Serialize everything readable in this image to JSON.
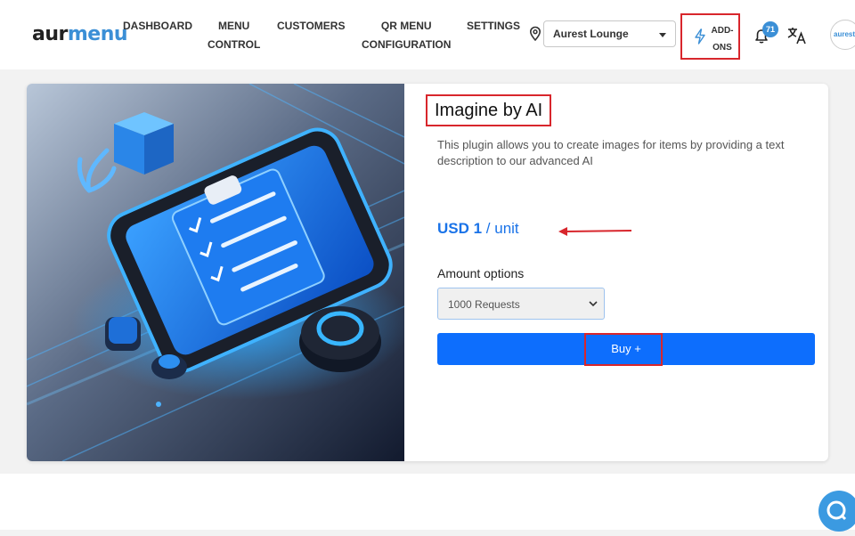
{
  "logo": {
    "part1": "aur",
    "part2": "menu"
  },
  "nav": [
    {
      "line1": "DASHBOARD",
      "line2": ""
    },
    {
      "line1": "MENU",
      "line2": "CONTROL"
    },
    {
      "line1": "CUSTOMERS",
      "line2": ""
    },
    {
      "line1": "QR MENU",
      "line2": "CONFIGURATION"
    },
    {
      "line1": "SETTINGS",
      "line2": ""
    }
  ],
  "location": {
    "selected": "Aurest Lounge"
  },
  "addons": {
    "line1": "ADD-",
    "line2": "ONS"
  },
  "notifications": {
    "count": "71"
  },
  "avatar": {
    "text": "aurest"
  },
  "product": {
    "title": "Imagine by AI",
    "description": "This plugin allows you to create images for items by providing a text description to our advanced AI",
    "price_currency": "USD 1",
    "price_unit": " / unit",
    "amount_label": "Amount options",
    "amount_selected": "1000 Requests",
    "buy_label": "Buy +"
  },
  "colors": {
    "accent": "#0d6efd",
    "highlight": "#d8262c",
    "brand": "#3b8fd6"
  },
  "icons": [
    "location-pin-icon",
    "lightning-icon",
    "bell-icon",
    "translate-icon",
    "chevron-down-icon",
    "chat-icon"
  ]
}
